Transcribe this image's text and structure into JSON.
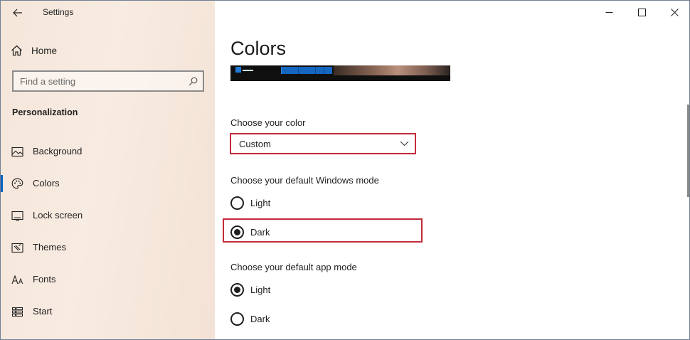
{
  "app": {
    "title": "Settings"
  },
  "sidebar": {
    "home_label": "Home",
    "search_placeholder": "Find a setting",
    "section_title": "Personalization",
    "items": [
      {
        "label": "Background",
        "icon": "picture-icon"
      },
      {
        "label": "Colors",
        "icon": "palette-icon",
        "selected": true
      },
      {
        "label": "Lock screen",
        "icon": "lock-screen-icon"
      },
      {
        "label": "Themes",
        "icon": "themes-icon"
      },
      {
        "label": "Fonts",
        "icon": "fonts-icon"
      },
      {
        "label": "Start",
        "icon": "start-icon"
      }
    ]
  },
  "main": {
    "title": "Colors",
    "choose_color_label": "Choose your color",
    "choose_color_value": "Custom",
    "windows_mode_label": "Choose your default Windows mode",
    "windows_mode_options": [
      {
        "label": "Light",
        "selected": false
      },
      {
        "label": "Dark",
        "selected": true
      }
    ],
    "app_mode_label": "Choose your default app mode",
    "app_mode_options": [
      {
        "label": "Light",
        "selected": true
      },
      {
        "label": "Dark",
        "selected": false
      }
    ]
  },
  "colors": {
    "accent": "#0a62c4",
    "highlight_box": "#c42b3a"
  }
}
